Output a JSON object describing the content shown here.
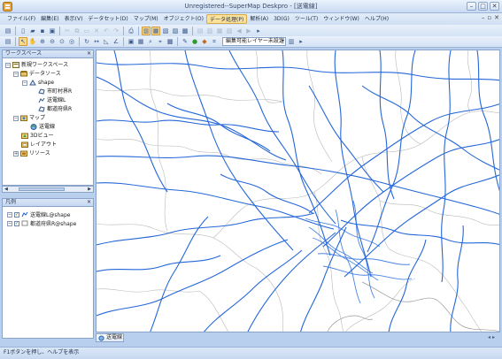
{
  "window": {
    "title": "Unregistered--SuperMap Deskpro - [送電線]"
  },
  "menu": {
    "items": [
      "ファイル(F)",
      "編集(E)",
      "表示(V)",
      "データセット(D)",
      "マップ(M)",
      "オブジェクト(O)",
      "データ処理(P)",
      "解析(A)",
      "3D(G)",
      "ツール(T)",
      "ウィンドウ(W)",
      "ヘルプ(H)"
    ],
    "active_index": 6
  },
  "toolbar": {
    "editable_layer_label": "編集可能レイヤー未設定"
  },
  "workspace": {
    "title": "ワークスペース",
    "tree": {
      "root": "新規ワークスペース",
      "datasources": "データソース",
      "shape": "shape",
      "datasets": [
        "市町村界R",
        "送電線L",
        "都道府県R"
      ],
      "maps": "マップ",
      "map_item": "送電線",
      "scenes": "3Dビュー",
      "layouts": "レイアウト",
      "resources": "リソース"
    }
  },
  "legend": {
    "title": "凡例",
    "items": [
      {
        "label": "送電線L@shape",
        "checked": true
      },
      {
        "label": "都道府県R@shape",
        "checked": true
      }
    ]
  },
  "map": {
    "tab_label": "送電線",
    "line_color": "#1a5fd6",
    "boundary_color": "#b8b8b8"
  },
  "status": {
    "text": "F1ボタンを押し、ヘルプを表示"
  },
  "colors": {
    "chrome": "#c8daf3",
    "accent": "#fbd88a"
  }
}
